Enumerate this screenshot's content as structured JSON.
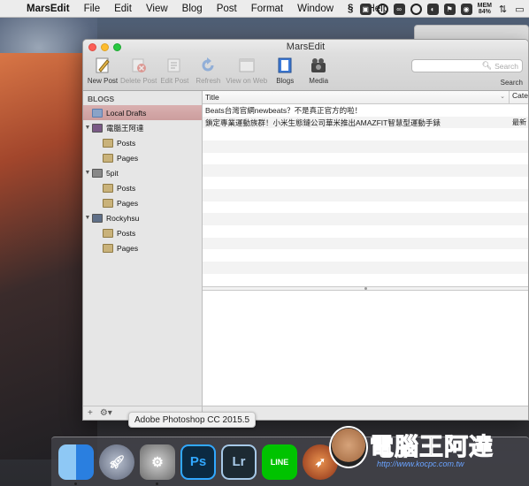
{
  "menubar": {
    "apple": "",
    "app_name": "MarsEdit",
    "items": [
      "File",
      "Edit",
      "View",
      "Blog",
      "Post",
      "Format",
      "Window",
      "Help"
    ],
    "mem_label": "MEM",
    "mem_value": "84%"
  },
  "window": {
    "title": "MarsEdit"
  },
  "toolbar": {
    "buttons": [
      {
        "label": "New Post",
        "icon": "new-post-pencil-icon",
        "enabled": true
      },
      {
        "label": "Delete Post",
        "icon": "delete-icon",
        "enabled": false
      },
      {
        "label": "Edit Post",
        "icon": "edit-post-icon",
        "enabled": false
      },
      {
        "label": "Refresh",
        "icon": "refresh-icon",
        "enabled": false
      },
      {
        "label": "View on Web",
        "icon": "view-on-web-icon",
        "enabled": false
      },
      {
        "label": "Blogs",
        "icon": "blogs-icon",
        "enabled": true
      },
      {
        "label": "Media",
        "icon": "media-camera-icon",
        "enabled": true
      }
    ],
    "search_placeholder": "Search",
    "search_label": "Search"
  },
  "sidebar": {
    "header": "BLOGS",
    "local_drafts": "Local Drafts",
    "blogs": [
      {
        "name": "電腦王阿達",
        "posts": "Posts",
        "pages": "Pages"
      },
      {
        "name": "5pit",
        "posts": "Posts",
        "pages": "Pages"
      },
      {
        "name": "Rockyhsu",
        "posts": "Posts",
        "pages": "Pages"
      }
    ],
    "footer_add": "+",
    "footer_gear": "⚙▾"
  },
  "list": {
    "col_title": "Title",
    "col_category": "Categ",
    "rows": [
      {
        "title": "Beats台灣官網newbeats？不是真正官方的啦！",
        "category": ""
      },
      {
        "title": "鎖定專業運動族群！小米生態鏈公司華米推出AMAZFIT智慧型運動手錶",
        "category": "最新"
      }
    ]
  },
  "dock": {
    "tooltip": "Adobe Photoshop CC 2015.5",
    "apps": [
      {
        "name": "finder-icon",
        "label": "",
        "color": "#3d8ee8"
      },
      {
        "name": "launchpad-icon",
        "label": "",
        "color": "#7b8496"
      },
      {
        "name": "system-preferences-icon",
        "label": "",
        "color": "#8d8d8d"
      },
      {
        "name": "photoshop-icon",
        "label": "Ps",
        "color": "#0b2a42"
      },
      {
        "name": "lightroom-icon",
        "label": "Lr",
        "color": "#1d2a33"
      },
      {
        "name": "line-icon",
        "label": "LINE",
        "color": "#00c300"
      },
      {
        "name": "marsedit-rocket-icon",
        "label": "",
        "color": "#c9562b"
      }
    ]
  },
  "watermark": {
    "text": "電腦王阿達",
    "url": "http://www.kocpc.com.tw"
  }
}
